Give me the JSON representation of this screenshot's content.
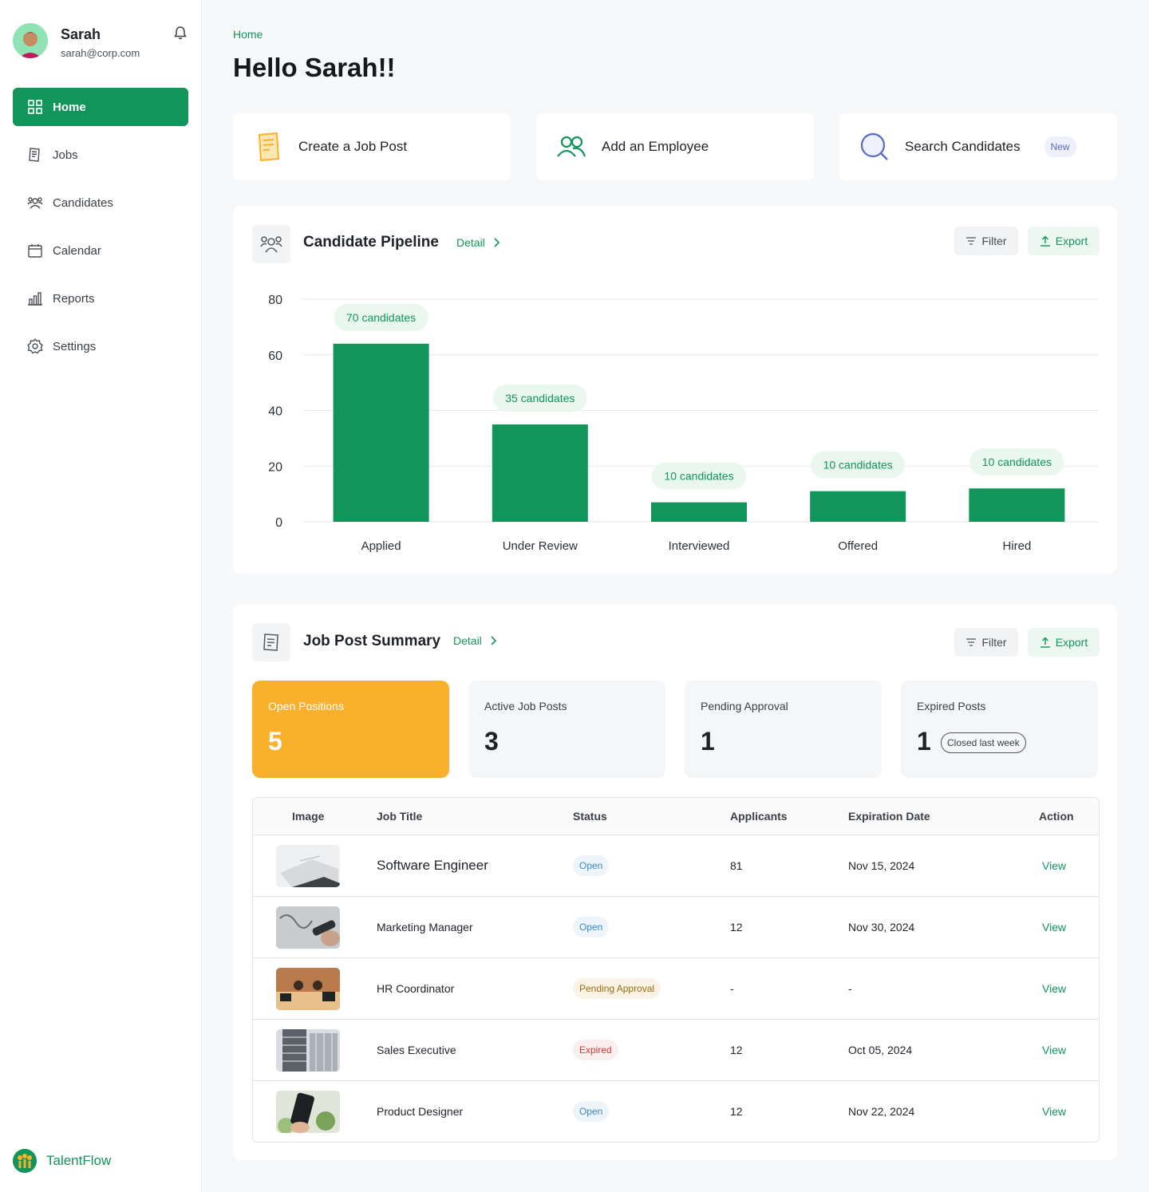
{
  "profile": {
    "name": "Sarah",
    "email": "sarah@corp.com"
  },
  "nav": {
    "items": [
      {
        "label": "Home",
        "icon": "grid-icon"
      },
      {
        "label": "Jobs",
        "icon": "document-icon"
      },
      {
        "label": "Candidates",
        "icon": "users-icon"
      },
      {
        "label": "Calendar",
        "icon": "calendar-icon"
      },
      {
        "label": "Reports",
        "icon": "bar-chart-icon"
      },
      {
        "label": "Settings",
        "icon": "gear-icon"
      }
    ]
  },
  "brand": {
    "name": "TalentFlow"
  },
  "breadcrumb": "Home",
  "greeting": "Hello Sarah!!",
  "quick_actions": [
    {
      "label": "Create a Job Post",
      "icon": "document-icon"
    },
    {
      "label": "Add an Employee",
      "icon": "users-icon"
    },
    {
      "label": "Search Candidates",
      "icon": "search-icon",
      "badge": "New"
    }
  ],
  "pipeline": {
    "title": "Candidate Pipeline",
    "detail": "Detail",
    "filter": "Filter",
    "export": "Export"
  },
  "chart_data": {
    "type": "bar",
    "categories": [
      "Applied",
      "Under Review",
      "Interviewed",
      "Offered",
      "Hired"
    ],
    "values": [
      64,
      35,
      7,
      11,
      12
    ],
    "data_labels": [
      "70 candidates",
      "35 candidates",
      "10 candidates",
      "10 candidates",
      "10 candidates"
    ],
    "yticks": [
      0,
      20,
      40,
      60,
      80
    ],
    "ylim": [
      0,
      80
    ],
    "color": "#11955a",
    "grid": true
  },
  "summary": {
    "title": "Job Post Summary",
    "detail": "Detail",
    "filter": "Filter",
    "export": "Export",
    "stats": [
      {
        "label": "Open Positions",
        "value": "5"
      },
      {
        "label": "Active Job Posts",
        "value": "3"
      },
      {
        "label": "Pending Approval",
        "value": "1"
      },
      {
        "label": "Expired Posts",
        "value": "1",
        "note": "Closed last week"
      }
    ]
  },
  "table": {
    "headers": [
      "Image",
      "Job Title",
      "Status",
      "Applicants",
      "Expiration Date",
      "Action"
    ],
    "rows": [
      {
        "title": "Software Engineer",
        "status": "Open",
        "applicants": "81",
        "expires": "Nov 15, 2024",
        "action": "View"
      },
      {
        "title": "Marketing Manager",
        "status": "Open",
        "applicants": "12",
        "expires": "Nov 30, 2024",
        "action": "View"
      },
      {
        "title": "HR Coordinator",
        "status": "Pending Approval",
        "applicants": "-",
        "expires": "-",
        "action": "View"
      },
      {
        "title": "Sales Executive",
        "status": "Expired",
        "applicants": "12",
        "expires": "Oct 05, 2024",
        "action": "View"
      },
      {
        "title": "Product Designer",
        "status": "Open",
        "applicants": "12",
        "expires": "Nov 22, 2024",
        "action": "View"
      }
    ]
  }
}
